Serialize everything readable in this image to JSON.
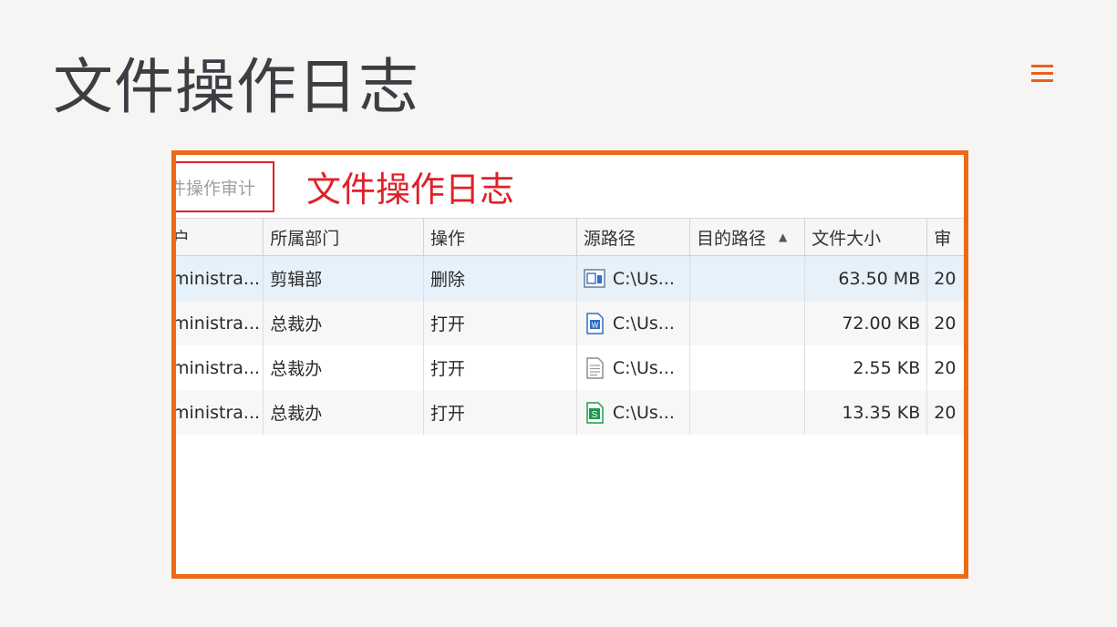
{
  "slide": {
    "title": "文件操作日志"
  },
  "menu": {
    "icon": "hamburger-menu-icon"
  },
  "screenshot": {
    "tab_label": "件操作审计",
    "annotation": "文件操作日志",
    "columns": [
      "户",
      "所属部门",
      "操作",
      "源路径",
      "目的路径",
      "文件大小",
      "审"
    ],
    "sorted_column": "目的路径",
    "sort_direction": "ascending",
    "rows": [
      {
        "user": "ministra...",
        "department": "剪辑部",
        "action": "删除",
        "icon": "presentation-file-icon",
        "source_path": "C:\\Us...",
        "dest_path": "",
        "size": "63.50 MB",
        "time": "20",
        "selected": true
      },
      {
        "user": "ministra...",
        "department": "总裁办",
        "action": "打开",
        "icon": "word-file-icon",
        "source_path": "C:\\Us...",
        "dest_path": "",
        "size": "72.00 KB",
        "time": "20",
        "selected": false
      },
      {
        "user": "ministra...",
        "department": "总裁办",
        "action": "打开",
        "icon": "text-file-icon",
        "source_path": "C:\\Us...",
        "dest_path": "",
        "size": "2.55 KB",
        "time": "20",
        "selected": false
      },
      {
        "user": "ministra...",
        "department": "总裁办",
        "action": "打开",
        "icon": "spreadsheet-file-icon",
        "source_path": "C:\\Us...",
        "dest_path": "",
        "size": "13.35 KB",
        "time": "20",
        "selected": false
      }
    ]
  },
  "colors": {
    "accent": "#ee6a14",
    "annotation_red": "#e0202a",
    "title_text": "#3b3f44",
    "selected_row": "#e6f1fa"
  }
}
